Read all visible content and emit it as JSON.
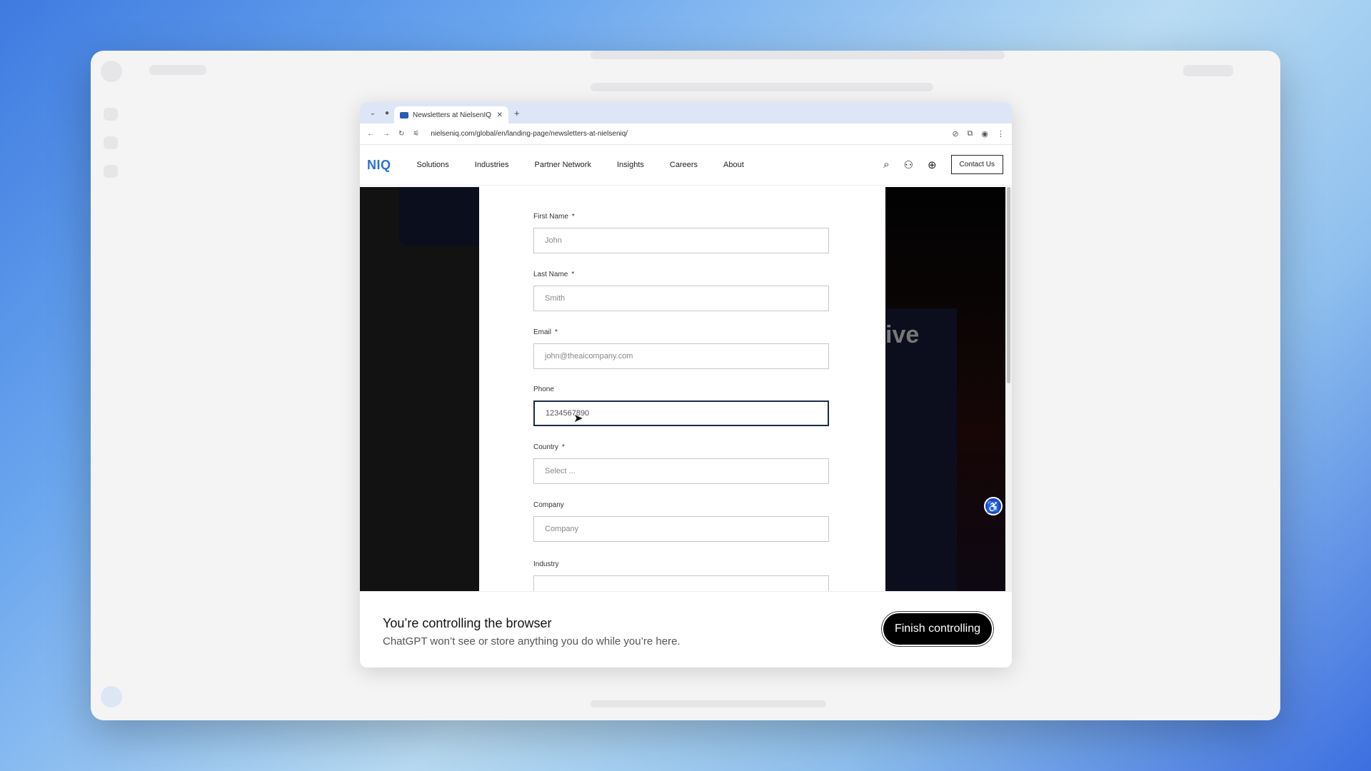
{
  "browser": {
    "tab_title": "Newsletters at NielsenIQ - N",
    "url": "nielseniq.com/global/en/landing-page/newsletters-at-nielseniq/"
  },
  "site": {
    "logo": "NIQ",
    "nav": [
      "Solutions",
      "Industries",
      "Partner Network",
      "Insights",
      "Careers",
      "About"
    ],
    "contact_label": "Contact Us",
    "bg_heading_fragment": "ive"
  },
  "form": {
    "first_name": {
      "label": "First Name",
      "required": "*",
      "placeholder": "John"
    },
    "last_name": {
      "label": "Last Name",
      "required": "*",
      "placeholder": "Smith"
    },
    "email": {
      "label": "Email",
      "required": "*",
      "placeholder": "john@theaicompany.com"
    },
    "phone": {
      "label": "Phone",
      "value": "1234567890"
    },
    "country": {
      "label": "Country",
      "required": "*",
      "placeholder": "Select ..."
    },
    "company": {
      "label": "Company",
      "placeholder": "Company"
    },
    "industry": {
      "label": "Industry"
    }
  },
  "control_bar": {
    "title": "You’re controlling the browser",
    "subtitle": "ChatGPT won’t see or store anything you do while you’re here.",
    "finish_label": "Finish controlling"
  }
}
